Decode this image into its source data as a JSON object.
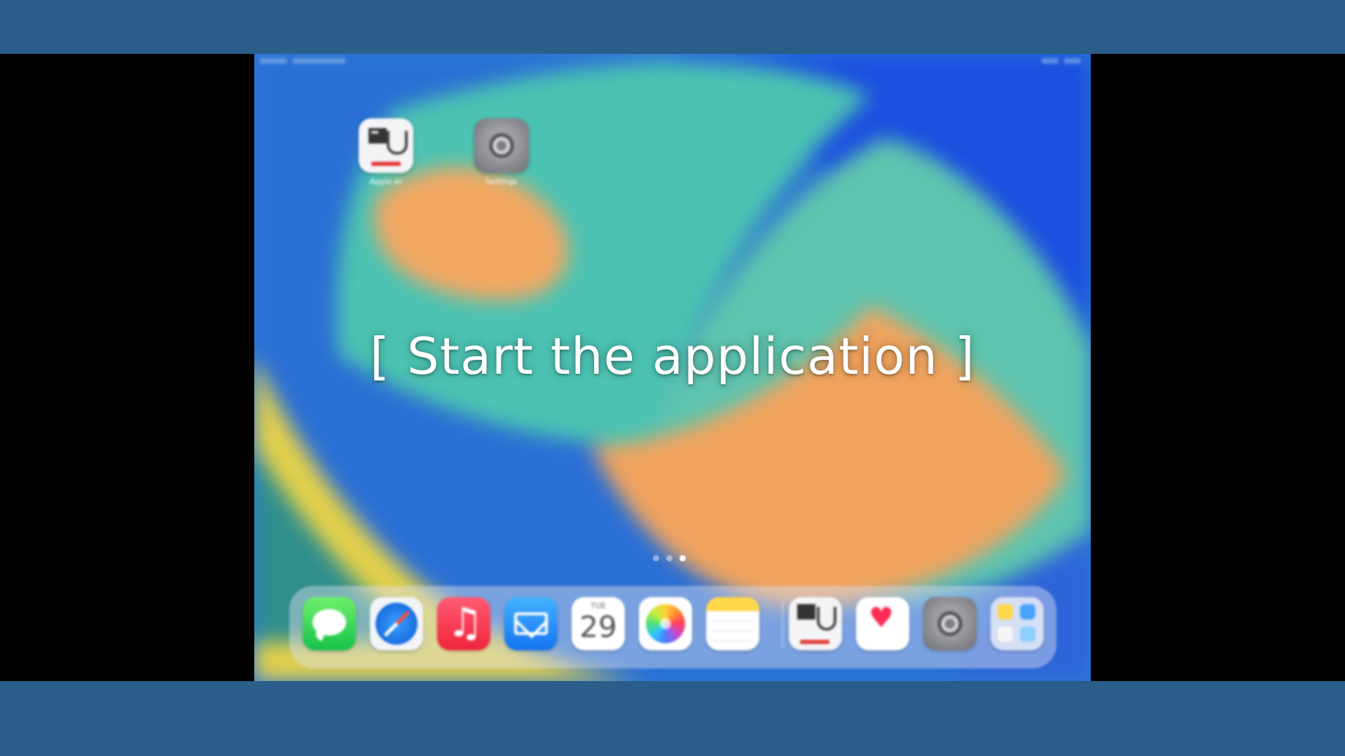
{
  "overlay": {
    "title": "[ Start the application ]"
  },
  "home_screen": {
    "apps": [
      {
        "name": "Apple-er",
        "icon": "demo-app-icon"
      },
      {
        "name": "Settings",
        "icon": "settings-gear-icon"
      }
    ],
    "page_indicator": {
      "pages": 3,
      "current": 3
    }
  },
  "dock": {
    "apps": [
      {
        "name": "Messages",
        "icon": "messages-icon"
      },
      {
        "name": "Safari",
        "icon": "safari-compass-icon"
      },
      {
        "name": "Music",
        "icon": "music-note-icon"
      },
      {
        "name": "Mail",
        "icon": "mail-envelope-icon"
      },
      {
        "name": "Calendar",
        "icon": "calendar-icon",
        "day": "TUE",
        "date": "29"
      },
      {
        "name": "Photos",
        "icon": "photos-flower-icon"
      },
      {
        "name": "Notes",
        "icon": "notes-icon"
      },
      {
        "name": "Apple-er",
        "icon": "demo-app-icon"
      },
      {
        "name": "Health",
        "icon": "health-heart-icon"
      },
      {
        "name": "Settings",
        "icon": "settings-gear-icon"
      },
      {
        "name": "App Library",
        "icon": "app-library-icon"
      }
    ]
  },
  "colors": {
    "frame_band": "#2b5d8a",
    "letterbox": "#000000",
    "wallpaper_blue": "#2c79d6",
    "wallpaper_teal": "#4fc3b0",
    "wallpaper_orange": "#f0a060",
    "wallpaper_yellow": "#e3d04a"
  }
}
